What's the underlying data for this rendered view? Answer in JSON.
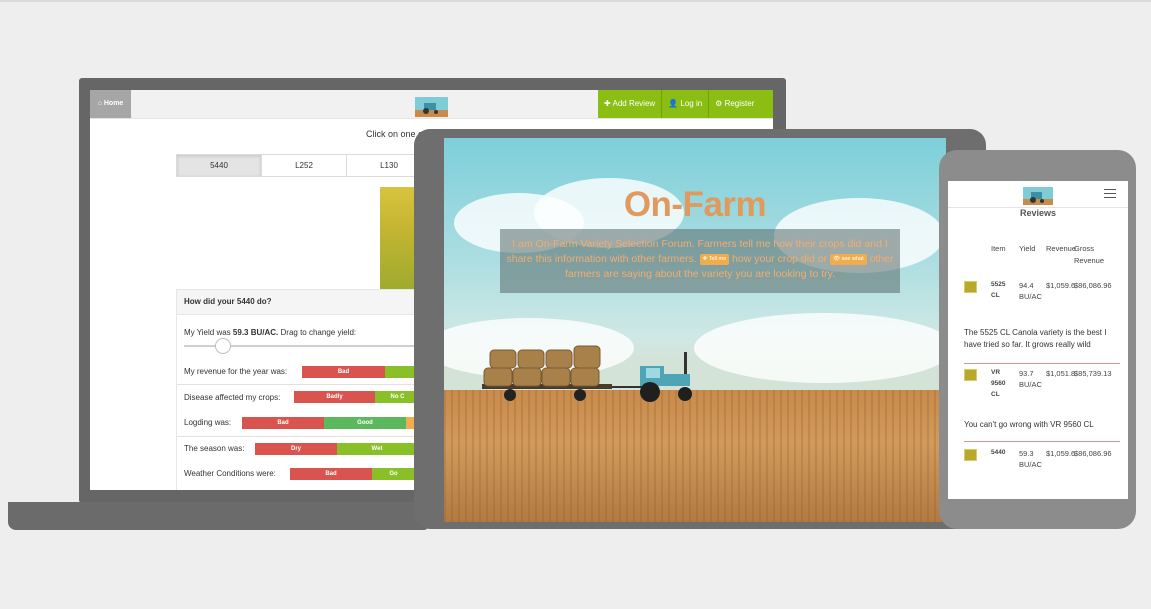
{
  "laptop": {
    "nav": {
      "home_label": "Home",
      "add_review_label": "Add Review",
      "login_label": "Log in",
      "register_label": "Register",
      "brand_color": "#8bbe12"
    },
    "prompt": "Click on one of",
    "tabs": [
      "5440",
      "L252",
      "L130"
    ],
    "active_tab": "5440",
    "form": {
      "title": "How did your 5440 do?",
      "yield_prefix": "My Yield was",
      "yield_value": "59.3 BU/AC.",
      "yield_suffix": "Drag to change yield:",
      "revenue_label": "My revenue for the year was:",
      "revenue_options": [
        "Bad",
        ""
      ],
      "disease_label": "Disease affected my crops:",
      "disease_options": [
        "Badly",
        "No C"
      ],
      "lodging_label": "Logding was:",
      "lodging_options": [
        "Bad",
        "Good",
        ""
      ],
      "season_label": "The season was:",
      "season_options": [
        "Dry",
        "Wet"
      ],
      "weather_label": "Weather Conditions were:",
      "weather_options": [
        "Bad",
        "Go"
      ]
    }
  },
  "tablet": {
    "hero_title": "On-Farm",
    "hero_text_1": "I am On-Farm Variety Selection Forum. Farmers tell me how their crops did and I share this information with other farmers.",
    "tell_me_label": "Tell me",
    "hero_text_2": "how your crop did or",
    "see_what_label": "see what",
    "hero_text_3": "other farmers are saying about the variety you are looking to try.",
    "title_color": "#e09a5e"
  },
  "phone": {
    "page_title": "Reviews",
    "columns": [
      "Item",
      "Yield",
      "Revenue",
      "Gross Revenue"
    ],
    "rows": [
      {
        "item": "5525 CL",
        "yield": "94.4 BU/AC",
        "revenue": "$1,059.6",
        "gross": "$86,086.96"
      },
      {
        "item": "VR 9560 CL",
        "yield": "93.7 BU/AC",
        "revenue": "$1,051.8",
        "gross": "$85,739.13"
      },
      {
        "item": "5440",
        "yield": "59.3 BU/AC",
        "revenue": "$1,059.6",
        "gross": "$86,086.96"
      }
    ],
    "reviews": [
      "The 5525 CL Canola variety is the best I have tried so far. It grows really wild",
      "You can't go wrong with VR 9560 CL"
    ]
  }
}
